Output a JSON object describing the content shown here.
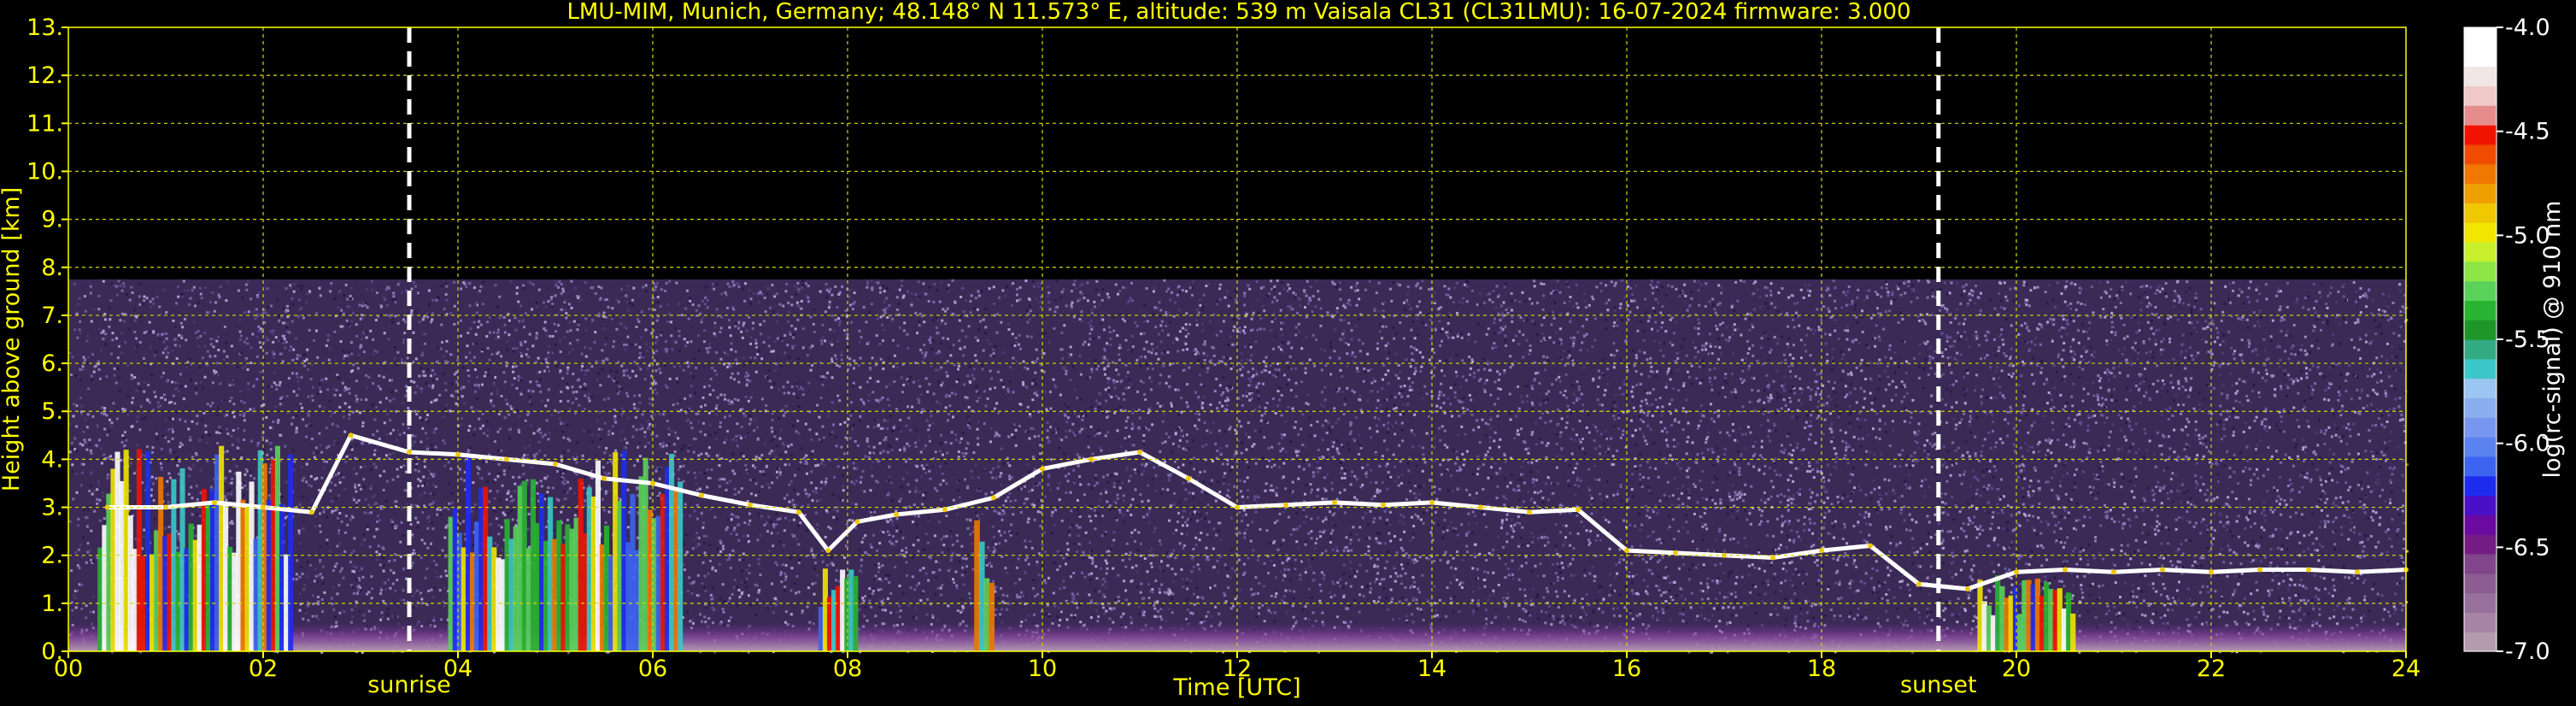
{
  "chart_data": {
    "type": "heatmap",
    "title": "LMU-MIM, Munich, Germany; 48.148° N 11.573° E, altitude: 539 m    Vaisala CL31 (CL31LMU): 16-07-2024    firmware: 3.000",
    "xlabel": "Time [UTC]",
    "ylabel": "Height above ground [km]",
    "xlim": [
      0,
      24
    ],
    "ylim": [
      0,
      13
    ],
    "x_ticks": [
      "00",
      "02",
      "04",
      "06",
      "08",
      "10",
      "12",
      "14",
      "16",
      "18",
      "20",
      "22",
      "24"
    ],
    "y_ticks": [
      "0.",
      "1.",
      "2.",
      "3.",
      "4.",
      "5.",
      "6.",
      "7.",
      "8.",
      "9.",
      "10.",
      "11.",
      "12.",
      "13."
    ],
    "grid": true,
    "events": [
      {
        "label": "sunrise",
        "time": 3.5
      },
      {
        "label": "sunset",
        "time": 19.2
      }
    ],
    "data_top_km": 7.75,
    "boundary_layer_top": [
      {
        "t": 0.4,
        "h": 3.0
      },
      {
        "t": 1.0,
        "h": 3.0
      },
      {
        "t": 1.5,
        "h": 3.1
      },
      {
        "t": 2.0,
        "h": 3.0
      },
      {
        "t": 2.5,
        "h": 2.9
      },
      {
        "t": 2.9,
        "h": 4.5
      },
      {
        "t": 3.5,
        "h": 4.15
      },
      {
        "t": 4.0,
        "h": 4.1
      },
      {
        "t": 4.5,
        "h": 4.0
      },
      {
        "t": 5.0,
        "h": 3.9
      },
      {
        "t": 5.5,
        "h": 3.6
      },
      {
        "t": 6.0,
        "h": 3.5
      },
      {
        "t": 6.5,
        "h": 3.25
      },
      {
        "t": 7.0,
        "h": 3.05
      },
      {
        "t": 7.5,
        "h": 2.9
      },
      {
        "t": 7.8,
        "h": 2.1
      },
      {
        "t": 8.1,
        "h": 2.7
      },
      {
        "t": 8.5,
        "h": 2.85
      },
      {
        "t": 9.0,
        "h": 2.95
      },
      {
        "t": 9.5,
        "h": 3.2
      },
      {
        "t": 10.0,
        "h": 3.8
      },
      {
        "t": 10.5,
        "h": 4.0
      },
      {
        "t": 11.0,
        "h": 4.15
      },
      {
        "t": 11.5,
        "h": 3.6
      },
      {
        "t": 12.0,
        "h": 3.0
      },
      {
        "t": 12.5,
        "h": 3.05
      },
      {
        "t": 13.0,
        "h": 3.1
      },
      {
        "t": 13.5,
        "h": 3.05
      },
      {
        "t": 14.0,
        "h": 3.1
      },
      {
        "t": 14.5,
        "h": 3.0
      },
      {
        "t": 15.0,
        "h": 2.9
      },
      {
        "t": 15.5,
        "h": 2.95
      },
      {
        "t": 16.0,
        "h": 2.1
      },
      {
        "t": 16.5,
        "h": 2.05
      },
      {
        "t": 17.0,
        "h": 2.0
      },
      {
        "t": 17.5,
        "h": 1.95
      },
      {
        "t": 18.0,
        "h": 2.1
      },
      {
        "t": 18.5,
        "h": 2.2
      },
      {
        "t": 19.0,
        "h": 1.4
      },
      {
        "t": 19.5,
        "h": 1.3
      },
      {
        "t": 20.0,
        "h": 1.65
      },
      {
        "t": 20.5,
        "h": 1.7
      },
      {
        "t": 21.0,
        "h": 1.65
      },
      {
        "t": 21.5,
        "h": 1.7
      },
      {
        "t": 22.0,
        "h": 1.65
      },
      {
        "t": 22.5,
        "h": 1.7
      },
      {
        "t": 23.0,
        "h": 1.7
      },
      {
        "t": 23.5,
        "h": 1.65
      },
      {
        "t": 24.0,
        "h": 1.7
      }
    ],
    "precip_periods": [
      {
        "t0": 0.3,
        "t1": 2.3,
        "top": 4.3
      },
      {
        "t0": 3.9,
        "t1": 6.3,
        "top": 4.2
      },
      {
        "t0": 7.7,
        "t1": 8.1,
        "top": 2.0
      },
      {
        "t0": 9.3,
        "t1": 9.5,
        "top": 2.8
      },
      {
        "t0": 19.6,
        "t1": 20.6,
        "top": 1.6
      }
    ],
    "colorbar": {
      "label": "log(rc-signal) @ 910 nm",
      "min": -7.0,
      "max": -4.0,
      "ticks": [
        "-4.0",
        "-4.5",
        "-5.0",
        "-5.5",
        "-6.0",
        "-6.5",
        "-7.0"
      ],
      "colors": [
        "#b49cb0",
        "#a584a6",
        "#98709c",
        "#8c5c93",
        "#80458a",
        "#741c84",
        "#6a0aa0",
        "#4a10c8",
        "#1e2cf0",
        "#3c64f0",
        "#5a82f0",
        "#7896f0",
        "#8aaef0",
        "#9cc6f2",
        "#3cc8c8",
        "#32aa82",
        "#1e9628",
        "#28b432",
        "#5ad25a",
        "#8ce646",
        "#c8f02d",
        "#f0e600",
        "#f0c800",
        "#f0a000",
        "#f07800",
        "#f04b00",
        "#f01400",
        "#e68c8c",
        "#f0c8c8",
        "#f0e6e6",
        "#ffffff",
        "#ffffff"
      ]
    }
  }
}
